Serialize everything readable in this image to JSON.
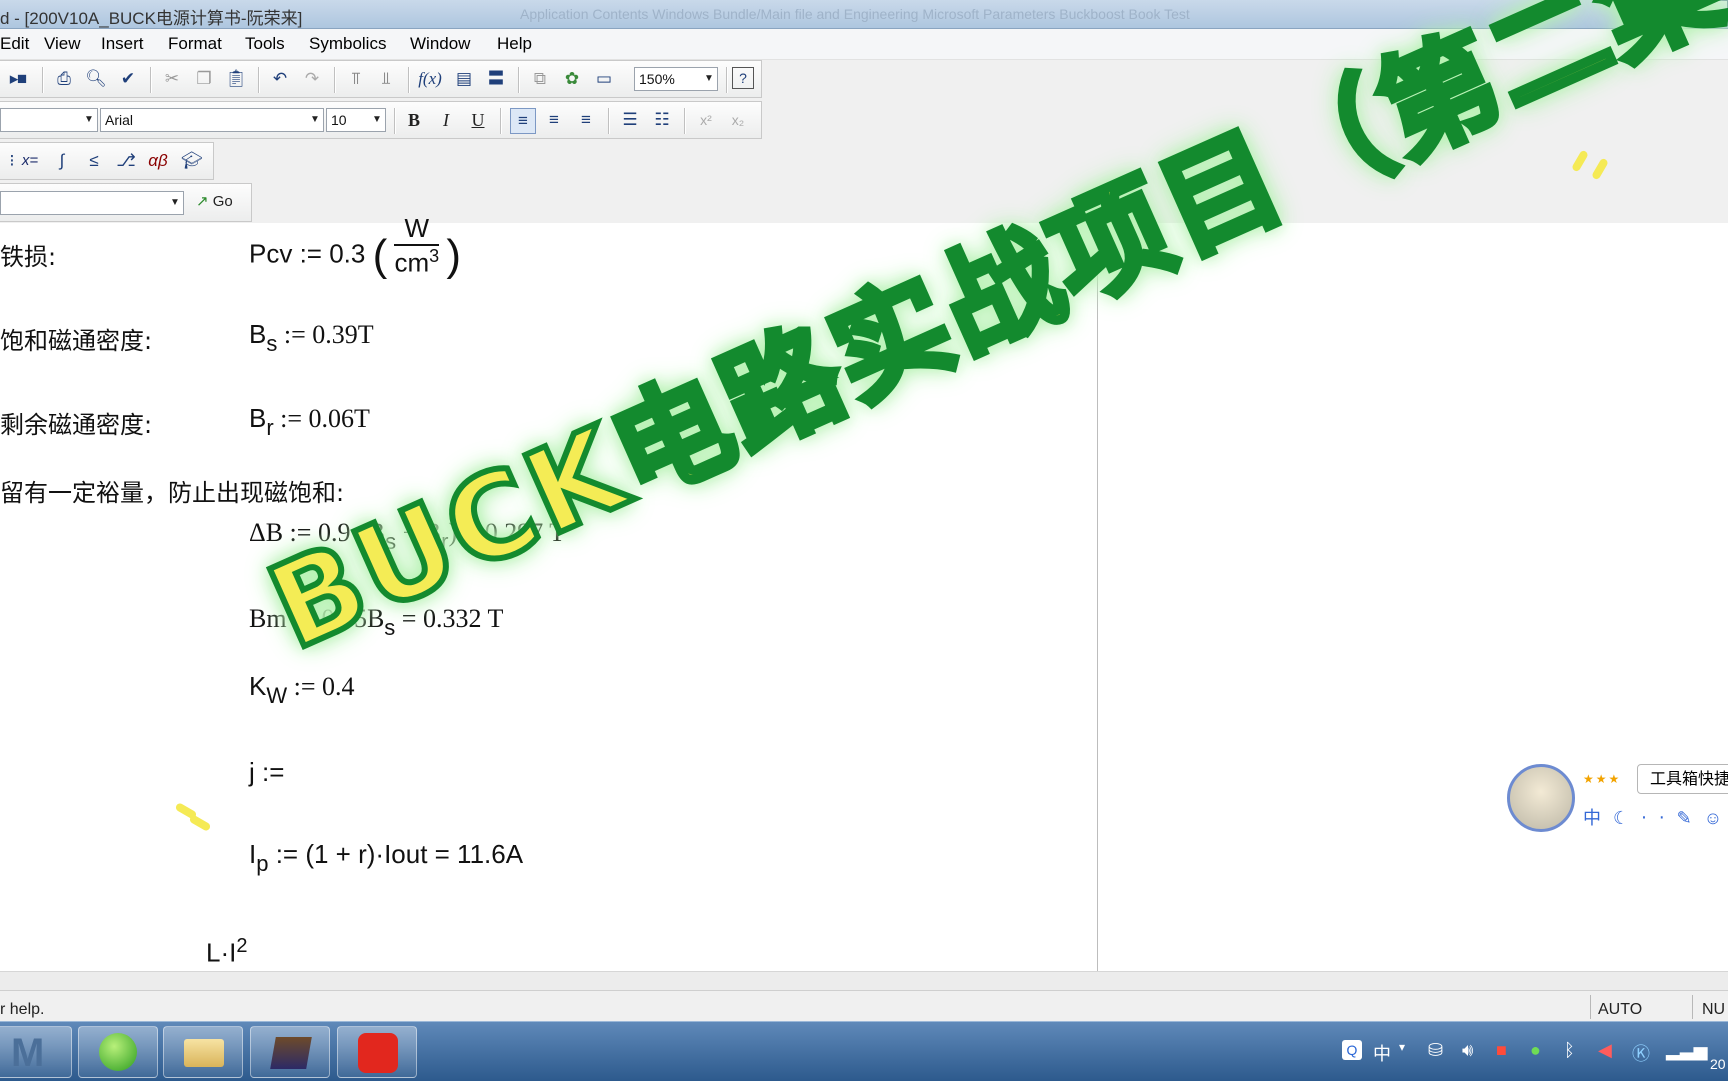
{
  "window": {
    "title": "d - [200V10A_BUCK电源计算书-阮荣来]",
    "background_tab_text": "Application Contents Windows Bundle/Main file and Engineering Microsoft Parameters Buckboost Book Test"
  },
  "menu": [
    "Edit",
    "View",
    "Insert",
    "Format",
    "Tools",
    "Symbolics",
    "Window",
    "Help"
  ],
  "toolbar": {
    "zoom": "150%",
    "font_name": "Arial",
    "font_size": "10",
    "bold": "B",
    "italic": "I",
    "underline": "U",
    "go_label": "Go"
  },
  "document": {
    "rows": [
      {
        "label": "铁损:",
        "expr": "Pcv := 0.3",
        "frac_num": "W",
        "frac_den": "cm",
        "frac_exp": "3"
      },
      {
        "label": "饱和磁通密度:",
        "lhs": "B",
        "sub": "s",
        "rhs": " := 0.39T"
      },
      {
        "label": "剩余磁通密度:",
        "lhs": "B",
        "sub": "r",
        "rhs": " := 0.06T"
      },
      {
        "label": "留有一定裕量，防止出现磁饱和:"
      },
      {
        "expr": "ΔB := 0.9·(B",
        "sub1": "s",
        "mid": " − B",
        "sub2": "r",
        "tail": ") = 0.297 T"
      },
      {
        "expr": "Bm := 0.85B",
        "sub": "s",
        "tail": " = 0.332 T"
      },
      {
        "lhs": "K",
        "sub": "W",
        "rhs": " := 0.4"
      },
      {
        "lhs": "j :="
      },
      {
        "lhs": "I",
        "sub": "p",
        "rhs": " := (1 + r)·Iout = 11.6A"
      },
      {
        "lhs": "L·I",
        "sup": "2"
      }
    ]
  },
  "status": {
    "help": "r help.",
    "auto": "AUTO",
    "num": "NU"
  },
  "overlay": {
    "banner": "BUCK电路实战项目（第二集）"
  },
  "ime": {
    "tooltip": "工具箱快捷",
    "lang": "中",
    "stars": "★★★"
  },
  "tray": {
    "lang": "中",
    "clock": "20"
  }
}
